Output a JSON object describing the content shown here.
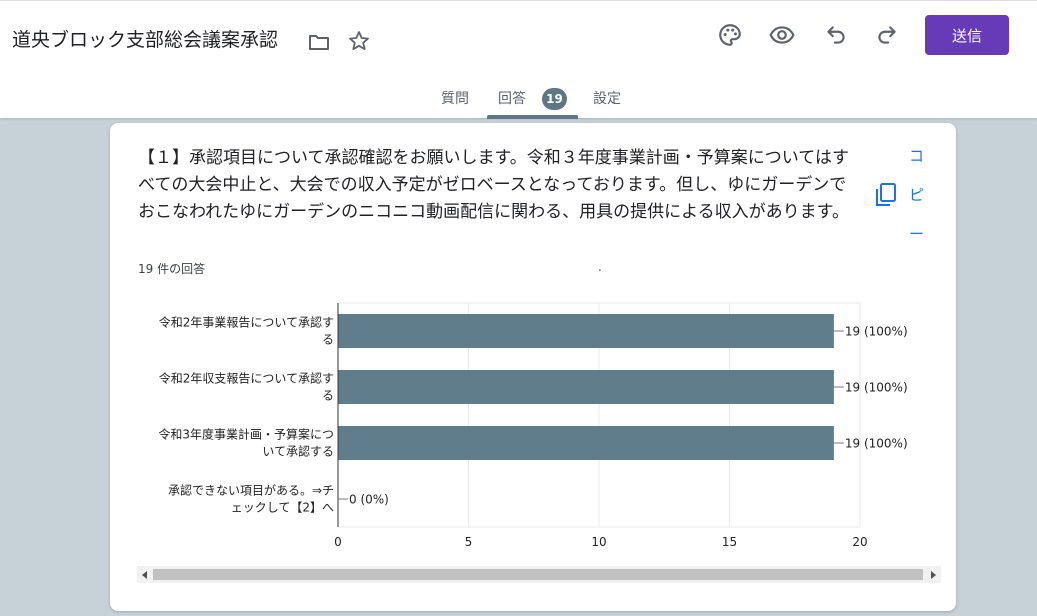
{
  "header": {
    "title": "道央ブロック支部総会議案承認",
    "send_label": "送信",
    "icons": [
      "folder-icon",
      "star-icon",
      "palette-icon",
      "eye-icon",
      "undo-icon",
      "redo-icon"
    ]
  },
  "tabs": {
    "questions": "質問",
    "responses": "回答",
    "responses_count": "19",
    "settings": "設定"
  },
  "question": {
    "text": "【１】承認項目について承認確認をお願いします。令和３年度事業計画・予算案についてはすべての大会中止と、大会での収入予定がゼロベースとなっております。但し、ゆにガーデンでおこなわれたゆにガーデンのニコニコ動画配信に関わる、用具の提供による収入があります。",
    "response_count": "19 件の回答",
    "dot": ".",
    "copy_label": [
      "コ",
      "ピ",
      "ー"
    ]
  },
  "colors": {
    "accent": "#673ab7",
    "bar": "#607d8b",
    "badge": "#5f7683"
  },
  "chart_data": {
    "type": "bar",
    "orientation": "horizontal",
    "categories": [
      [
        "令和2年事業報告について承認す",
        "る"
      ],
      [
        "令和2年収支報告について承認す",
        "る"
      ],
      [
        "令和3年度事業計画・予算案につ",
        "いて承認する"
      ],
      [
        "承認できない項目がある。⇒チ",
        "ェックして【2】へ"
      ]
    ],
    "values": [
      19,
      19,
      19,
      0
    ],
    "value_labels": [
      "19 (100%)",
      "19 (100%)",
      "19 (100%)",
      "0 (0%)"
    ],
    "xticks": [
      "0",
      "5",
      "10",
      "15",
      "20"
    ],
    "xlim": [
      0,
      20
    ],
    "grid": true
  }
}
